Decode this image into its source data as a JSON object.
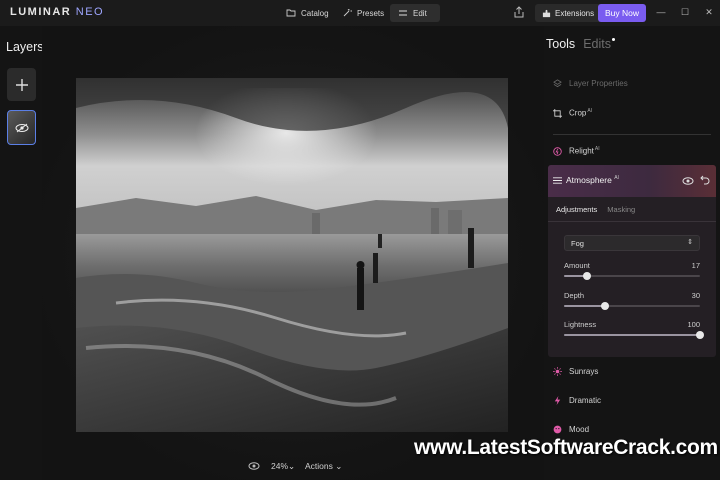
{
  "app": {
    "logo_main": "LUMINAR",
    "logo_accent": "NEO"
  },
  "topbar": {
    "catalog_label": "Catalog",
    "presets_label": "Presets",
    "edit_label": "Edit",
    "extensions_label": "Extensions",
    "buy_label": "Buy Now"
  },
  "layers": {
    "title": "Layers"
  },
  "canvas": {
    "zoom": "24%",
    "zoom_chevron": "⌄",
    "actions_label": "Actions"
  },
  "panel": {
    "tab_tools": "Tools",
    "tab_edits": "Edits",
    "layer_properties": "Layer Properties",
    "crop": "Crop",
    "crop_ai": "AI",
    "relight": "Relight",
    "relight_ai": "AI",
    "atmosphere": {
      "title": "Atmosphere",
      "ai_badge": "AI",
      "tab_adjustments": "Adjustments",
      "tab_masking": "Masking",
      "mode": "Fog",
      "sliders": [
        {
          "label": "Amount",
          "value": "17",
          "fraction": 0.17
        },
        {
          "label": "Depth",
          "value": "30",
          "fraction": 0.3
        },
        {
          "label": "Lightness",
          "value": "100",
          "fraction": 1.0
        }
      ]
    },
    "sunrays": "Sunrays",
    "dramatic": "Dramatic",
    "mood": "Mood"
  },
  "watermark": "www.LatestSoftwareCrack.com",
  "colors": {
    "accent": "#7a5cf0",
    "active_tool_header": "#4a2d49",
    "icon_pink": "#e05aa8"
  }
}
